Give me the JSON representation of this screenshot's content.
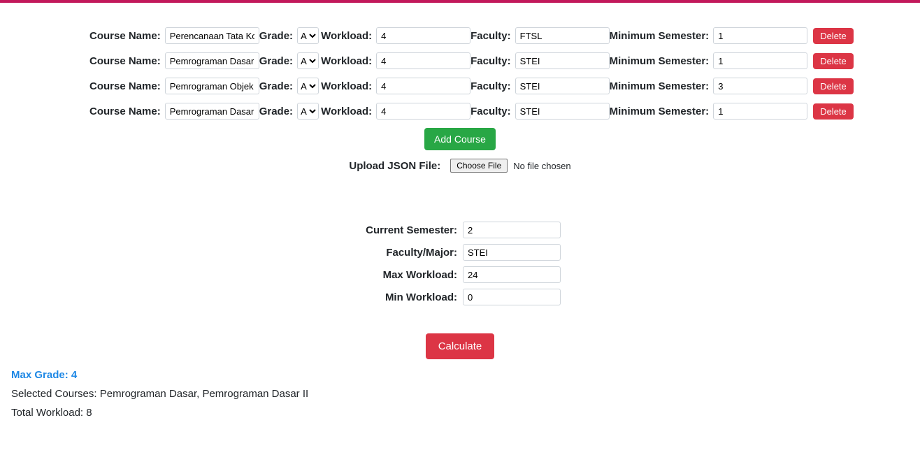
{
  "labels": {
    "course_name": "Course Name:",
    "grade": "Grade:",
    "workload": "Workload:",
    "faculty": "Faculty:",
    "min_semester": "Minimum Semester:",
    "delete": "Delete",
    "add_course": "Add Course",
    "upload_json": "Upload JSON File:",
    "choose_file": "Choose File",
    "no_file": "No file chosen",
    "current_semester": "Current Semester:",
    "faculty_major": "Faculty/Major:",
    "max_workload": "Max Workload:",
    "min_workload": "Min Workload:",
    "calculate": "Calculate"
  },
  "grade_option": "A",
  "courses": [
    {
      "name": "Perencanaan Tata Kota",
      "grade": "A",
      "workload": "4",
      "faculty": "FTSL",
      "min_semester": "1"
    },
    {
      "name": "Pemrograman Dasar",
      "grade": "A",
      "workload": "4",
      "faculty": "STEI",
      "min_semester": "1"
    },
    {
      "name": "Pemrograman Objek",
      "grade": "A",
      "workload": "4",
      "faculty": "STEI",
      "min_semester": "3"
    },
    {
      "name": "Pemrograman Dasar II",
      "grade": "A",
      "workload": "4",
      "faculty": "STEI",
      "min_semester": "1"
    }
  ],
  "params": {
    "current_semester": "2",
    "faculty_major": "STEI",
    "max_workload": "24",
    "min_workload": "0"
  },
  "results": {
    "max_grade_label": "Max Grade: ",
    "max_grade_value": "4",
    "selected_label": "Selected Courses: ",
    "selected_value": "Pemrograman Dasar, Pemrograman Dasar II",
    "total_workload_label": "Total Workload: ",
    "total_workload_value": "8"
  }
}
